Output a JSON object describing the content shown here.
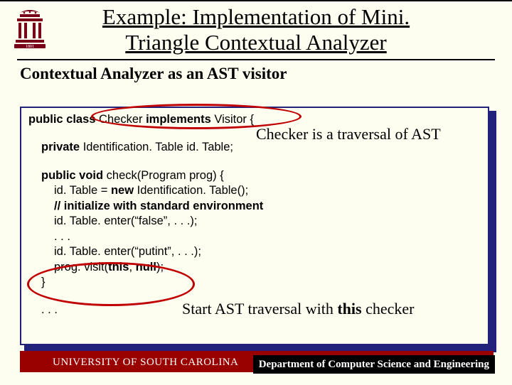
{
  "title_line1": "Example: Implementation of Mini.",
  "title_line2": "Triangle Contextual Analyzer",
  "subtitle": "Contextual Analyzer as an AST visitor",
  "code": {
    "l1_a": "public class",
    "l1_b": " Checker ",
    "l1_c": "implements",
    "l1_d": " Visitor {",
    "l2_a": "private",
    "l2_b": " Identification. Table id. Table;",
    "l3_a": "public void",
    "l3_b": " check(Program prog) {",
    "l4": "id. Table = ",
    "l4_b": "new",
    "l4_c": " Identification. Table();",
    "l5": "// initialize with standard environment",
    "l6": "id. Table. enter(“false”, . . .);",
    "l7": ". . .",
    "l8": "id. Table. enter(“putint”, . . .);",
    "l9_a": "prog. visit(",
    "l9_b": "this",
    "l9_c": ", ",
    "l9_d": "null",
    "l9_e": ");",
    "l10": "}",
    "l11": ". . ."
  },
  "annotation1": "Checker is a traversal of AST",
  "annotation2_a": "Start AST traversal with ",
  "annotation2_b": "this",
  "annotation2_c": " checker",
  "footer_left": "UNIVERSITY OF SOUTH CAROLINA",
  "footer_right": "Department of Computer Science and Engineering",
  "logo_year": "1801"
}
